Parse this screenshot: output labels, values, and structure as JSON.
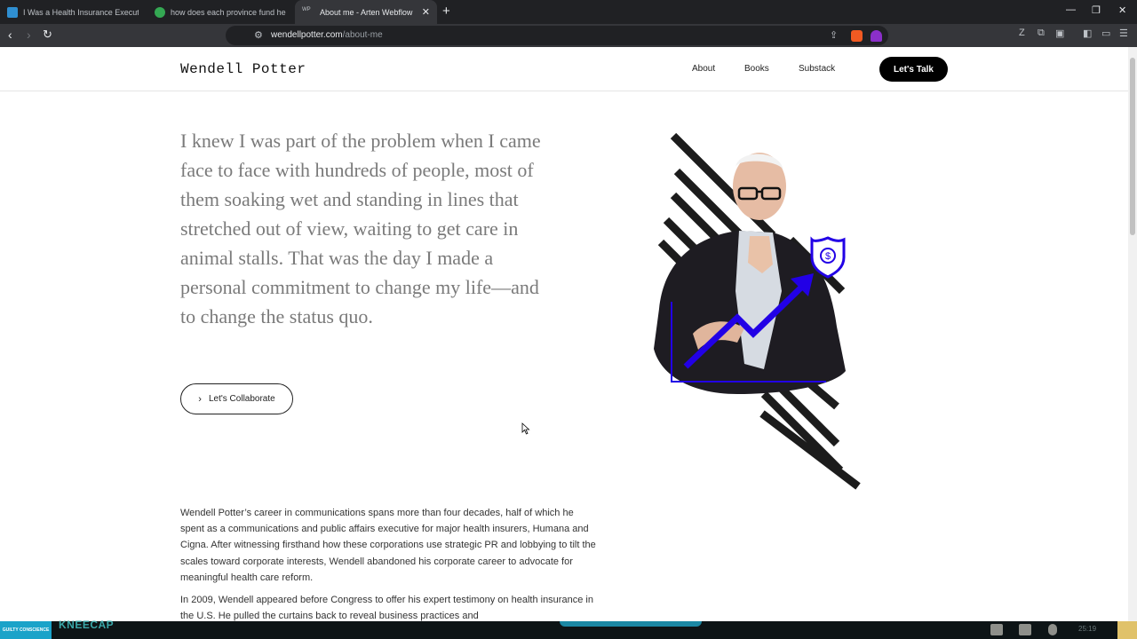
{
  "browser": {
    "tabs": [
      {
        "title": "I Was a Health Insurance Executive. W",
        "favicon_color": "#2f8fd1"
      },
      {
        "title": "how does each province fund health",
        "favicon_color": "#34a853"
      },
      {
        "title": "About me - Arten Webflow HTML",
        "favicon_label": "WP",
        "active": true
      }
    ],
    "new_tab_icon": "plus-icon",
    "url_domain": "wendellpotter.com",
    "url_path": "/about-me"
  },
  "site": {
    "logo": "Wendell Potter",
    "nav": [
      "About",
      "Books",
      "Substack"
    ],
    "cta": "Let's Talk",
    "quote": "I knew I was part of the problem when I came face to face with hundreds of people, most of them soaking wet and standing in lines that stretched out of view, waiting to get care in animal stalls. That was the day I made a personal commitment to change my life—and to change the status quo.",
    "collab_button": "Let's Collaborate",
    "bio": [
      "Wendell Potter’s career in communications spans more than four decades, half of which he spent as a communications and public affairs executive for major health insurers, Humana and Cigna. After witnessing firsthand how these corporations use strategic PR and lobbying to tilt the scales toward corporate interests, Wendell abandoned his corporate career to advocate for meaningful health care reform.",
      "In 2009, Wendell appeared before Congress to offer his expert testimony on health insurance in the U.S. He pulled the curtains back to reveal business practices and"
    ],
    "accent_color": "#2200e6",
    "shield_symbol": "$"
  },
  "taskbar": {
    "thumbnail_text": "GUILTY CONSCIENCE",
    "app_text": "KNEECAP",
    "clock": "25:19"
  }
}
